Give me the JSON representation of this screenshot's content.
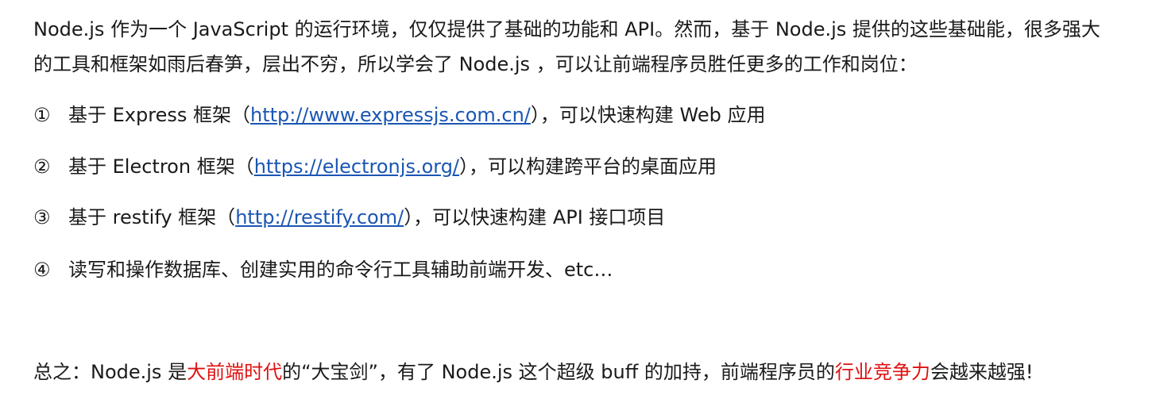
{
  "intro": {
    "line1": "Node.js 作为一个 JavaScript 的运行环境，仅仅提供了基础的功能和 API。然而，基于 Node.js 提供的这些基础能，很多强大",
    "line2": "的工具和框架如雨后春笋，层出不穷，所以学会了 Node.js ，可以让前端程序员胜任更多的工作和岗位："
  },
  "items": [
    {
      "num": "①",
      "before": "基于 Express 框架（",
      "link": "http://www.expressjs.com.cn/",
      "after": "），可以快速构建 Web 应用"
    },
    {
      "num": "②",
      "before": "基于 Electron 框架（",
      "link": "https://electronjs.org/",
      "after": "），可以构建跨平台的桌面应用"
    },
    {
      "num": "③",
      "before": "基于 restify 框架（",
      "link": "http://restify.com/",
      "after": "），可以快速构建 API 接口项目"
    },
    {
      "num": "④",
      "text": "读写和操作数据库、创建实用的命令行工具辅助前端开发、etc…"
    }
  ],
  "summary": {
    "part1": "总之：Node.js 是",
    "highlight1": "大前端时代",
    "part2": "的“大宝剑”，有了 Node.js 这个超级 buff 的加持，前端程序员的",
    "highlight2": "行业竞争力",
    "part3": "会越来越强!"
  },
  "colors": {
    "text": "#1a1a1a",
    "link": "#1a56b3",
    "highlight": "#e01010"
  }
}
